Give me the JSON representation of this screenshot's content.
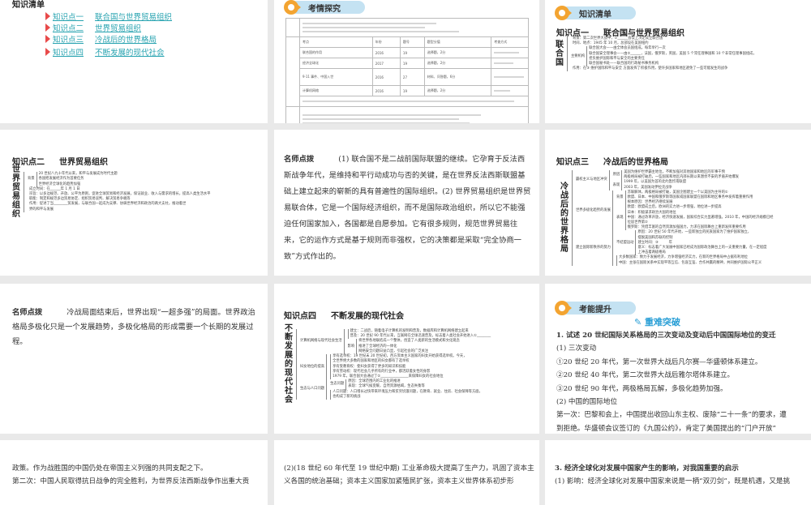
{
  "slides": {
    "toc": {
      "title": "知识清单",
      "items": [
        {
          "num": "知识点一",
          "label": "联合国与世界贸易组织"
        },
        {
          "num": "知识点二",
          "label": "世界贸易组织"
        },
        {
          "num": "知识点三",
          "label": "冷战后的世界格局"
        },
        {
          "num": "知识点四",
          "label": "不断发展的现代社会"
        }
      ]
    },
    "exam": {
      "badge": "考情探究",
      "table_header": [
        "考点",
        "年份",
        "题号",
        "题型分值",
        "考查方式"
      ],
      "table_rows": [
        [
          "联合国的作用",
          "2016",
          "19",
          "选择题，2分"
        ],
        [
          "经济全球化",
          "2017",
          "19",
          "选择题，2分"
        ],
        [
          "9·11 事件、中国入世",
          "2016",
          "27",
          "材料、问答题，6分"
        ],
        [
          "计算机网络",
          "2016",
          "19",
          "选择题，2分"
        ]
      ]
    },
    "un": {
      "badge": "知识清单",
      "heading_num": "知识点一",
      "heading": "联合国与世界贸易组织",
      "map": {
        "title": "联合国",
        "groups": [
          {
            "lines": [
              "背景：第二次世界大战中，①______会议上决定成立联合国",
              "时间、地点：1945 年 10 月，总部设在美国纽约"
            ]
          },
          {
            "label": "主要机构",
            "lines": [
              "联合国大会——由全体会员国组成，每年举行一次",
              "联合国安全理事会——由②______，法国，俄罗斯，英国，美国 5 个常任理事国和 10 个非常任理事国组成，",
              "担负维护国际和平与安全的主要责任",
              "联合国秘书处——联合国的行政秘书事务机构"
            ]
          },
          {
            "lines": [
              "作用：在③ 维护国际和平与安全 方面发挥了积极作用，使许多国家和地区避免了一些可能发生的战争"
            ]
          }
        ]
      }
    },
    "wto": {
      "heading_num": "知识点二",
      "heading": "世界贸易组织",
      "map": {
        "title": "世界贸易组织",
        "groups": [
          {
            "label": "背景",
            "lines": [
              "20 世纪八九十年代以来，和平与发展成为时代主题",
              "各国把发展经济作为首要任务",
              "世界经济全球化的趋势加强"
            ]
          },
          {
            "lines": [
              "成立时间：在______年 1 月 1 日",
              "宗旨：以多边规范、开放、公平为原则，促进全球贸易和经济发展，保证就业、收入与需求的增长，提高人类生活水平",
              "职能：制定和规范多边贸易协定、组织贸易谈判、解决贸易争端等",
              "作用：促进了当________贸发展，与联合国一起成为支撑、协调世界经济和政治的两大支柱，推动着世",
              "界的和平与发展"
            ]
          }
        ]
      }
    },
    "tip1": {
      "lead": "名师点拨",
      "text": "(1) 联合国不是二战前国际联盟的继续。它孕育于反法西斯战争年代，是维持和平行动成功与否的关键，是在世界反法西斯联盟基础上建立起来的崭新的具有普遍性的国际组织。(2) 世界贸易组织是世界贸易联合体，它是一个国际经济组织，而不是国际政治组织，所以它不能强迫任何国家加入，各国都是自愿参加。它有很多规则，规范世界贸易往来，它的运作方式是基于规则而非强权，它的决策都是采取“完全协商一致”方式作出的。"
    },
    "coldwar": {
      "heading_num": "知识点三",
      "heading": "冷战后的世界格局",
      "map": {
        "title": "冷战后的世界格局",
        "groups": [
          {
            "label": "霸权主义与地区冲突",
            "subs": [
              {
                "label": "原因",
                "lines": [
                  "美国为维护世界霸主地位，不断加强对其他国家和地区的军事干预",
                  "两极格局被打破后，一些国家和地区内部长期以来潜伏不安的矛盾开始爆发"
                ]
              },
              {
                "label": "表现",
                "lines": [
                  "1999 年，以美国为首的北约轰炸南联盟",
                  "2003 年，美国发动伊拉克战争"
                ]
              }
            ]
          },
          {
            "label": "世界多极化趋势的发展",
            "subs": [
              {
                "label": "背景",
                "lines": [
                  "苏联解体，两极格局被打破，美国企图建立一个以美国为主导的①",
                  "欧盟、日本、中国和俄罗斯等国家或国家联盟在国际和地区事务中发挥着重要作用",
                  "根本原因：世界经济继续发展"
                ]
              },
              {
                "label": "表现",
                "lines": [
                  "欧盟：欧盟成立后，欧洲的实力进一步增强，地位进一步提高",
                  "日本：积极谋求政治大国的地位",
                  "中国：通过改革开放，经济快速发展，国家综合实力显著增强。2010 年，中国的经济规模已经",
                  "位居世界第②",
                  "俄罗斯：凭借丰富的自然资源加强国力，力求在国际舞台上重新发挥重要作用"
                ]
              }
            ]
          },
          {
            "label": "建立国际新秩序的努力",
            "subs": [
              {
                "label": "不结盟运动",
                "lines": [
                  "原因：20 世纪 50 年代开始，一些新独立的民族国家为了维护国家独立，",
                  "摆脱美国和苏联的控制",
                  "建立时间：③　　　年",
                  "意义：标志着广大发展中国家已经成为国际政治舞台上的一支重要力量，在一定程度",
                  "上冲击着两极格局"
                ]
              },
              {
                "lines": [
                  "大多数国家：致力于发展经济，力争增强经济实力，在新的世界格局中占据有利地位",
                  "中国：主张在国际关系中实现平等互信、包容互鉴、合作共赢的精神，共同维护国际公平正义"
                ]
              }
            ]
          }
        ]
      }
    },
    "tip2": {
      "lead": "名师点拨",
      "text": "冷战局面结束后，世界出现“一超多强”的局面。世界政治格局多极化只是一个发展趋势，多极化格局的形成需要一个长期的发展过程。"
    },
    "modern": {
      "heading_num": "知识点四",
      "heading": "不断发展的现代社会",
      "map": {
        "title": "不断发展的现代社会",
        "groups": [
          {
            "label": "计算机网络与现代社会生活",
            "subs": [
              {
                "lines": [
                  "建立：二战后，随着电子计算机的发明和普及，数据库和计算机网络建立起来",
                  "普及：20 世纪 90 年代以来，互联网在全球迅速普及，标志着人类社会开始进入①________"
                ]
              },
              {
                "label": "影响",
                "lines": [
                  "将世界各地联结成一个整体，创造了人类新的生活模式和文化观念",
                  "推进了全球经济的一体化",
                  "网络安全问题日益凸显，引起社会的广泛关注"
                ]
              }
            ]
          },
          {
            "label": "妇女地位的提高",
            "subs": [
              {
                "lines": [
                  "享有选举权：19 世纪末 20 世纪初，西方资本主义国家的妇女开始获得选举权。今天，",
                  "全世界绝大多数的国家和地区的妇女都有了选举权",
                  "享有受教育权：使妇女获得了更多的知识和技能",
                  "享有劳动权：现代社会几乎所有的行业中，都活跃着女性的身影",
                  "1979 年，联合国大会通过了②________________来保障妇女的社会地位"
                ]
              }
            ]
          },
          {
            "label": "生态与人口问题",
            "subs": [
              {
                "label": "生态问题",
                "lines": [
                  "原因：全球范围内的工业化的推进",
                  "表现：全球气候变暖，自然资源枯竭，生态失衡等"
                ]
              },
              {
                "lines": [
                  "人口问题：人口增长过快带来环境压力和贫穷饥饿问题，在教育、就业、住房、社会保障等方面，",
                  "也构成了新的挑战"
                ]
              }
            ]
          }
        ]
      }
    },
    "ability": {
      "badge": "考能提升",
      "section": "重难突破",
      "lines": [
        {
          "text": "1. 试述 20 世纪国际关系格局的三次变动及变动后中国国际地位的变迁",
          "bold": true
        },
        {
          "text": "(1) 三次变动"
        },
        {
          "text": "①20 世纪 20 年代，第一次世界大战后凡尔赛—华盛顿体系建立。"
        },
        {
          "text": "②20 世纪 40 年代，第二次世界大战后雅尔塔体系建立。"
        },
        {
          "text": "③20 世纪 90 年代，两极格局瓦解，多极化趋势加强。"
        },
        {
          "text": "(2) 中国的国际地位"
        },
        {
          "text": "第一次：巴黎和会上，中国提出收回山东主权、废除“二十一条”的要求，遭"
        },
        {
          "text": "到拒绝。华盛顿会议签订的《九国公约》，肯定了美国提出的“门户开放”"
        }
      ]
    },
    "row4": [
      {
        "lines": [
          "政策。作为战胜国的中国仍处在帝国主义列强的共同支配之下。",
          "第二次：中国人民取得抗日战争的完全胜利，为世界反法西斯战争作出重大贡"
        ]
      },
      {
        "lines": [
          "(2)(18 世纪 60 年代至 19 世纪中期) 工业革命极大提高了生产力，巩固了资本主",
          "义各国的统治基础；资本主义国家加紧殖民扩张，资本主义世界体系初步形"
        ]
      },
      {
        "lines": [
          "3. 经济全球化对发展中国家产生的影响，对我国重要的启示",
          "(1) 影响：经济全球化对发展中国家来说是一柄“双刃剑”，既是机遇，又是挑"
        ]
      }
    ]
  }
}
